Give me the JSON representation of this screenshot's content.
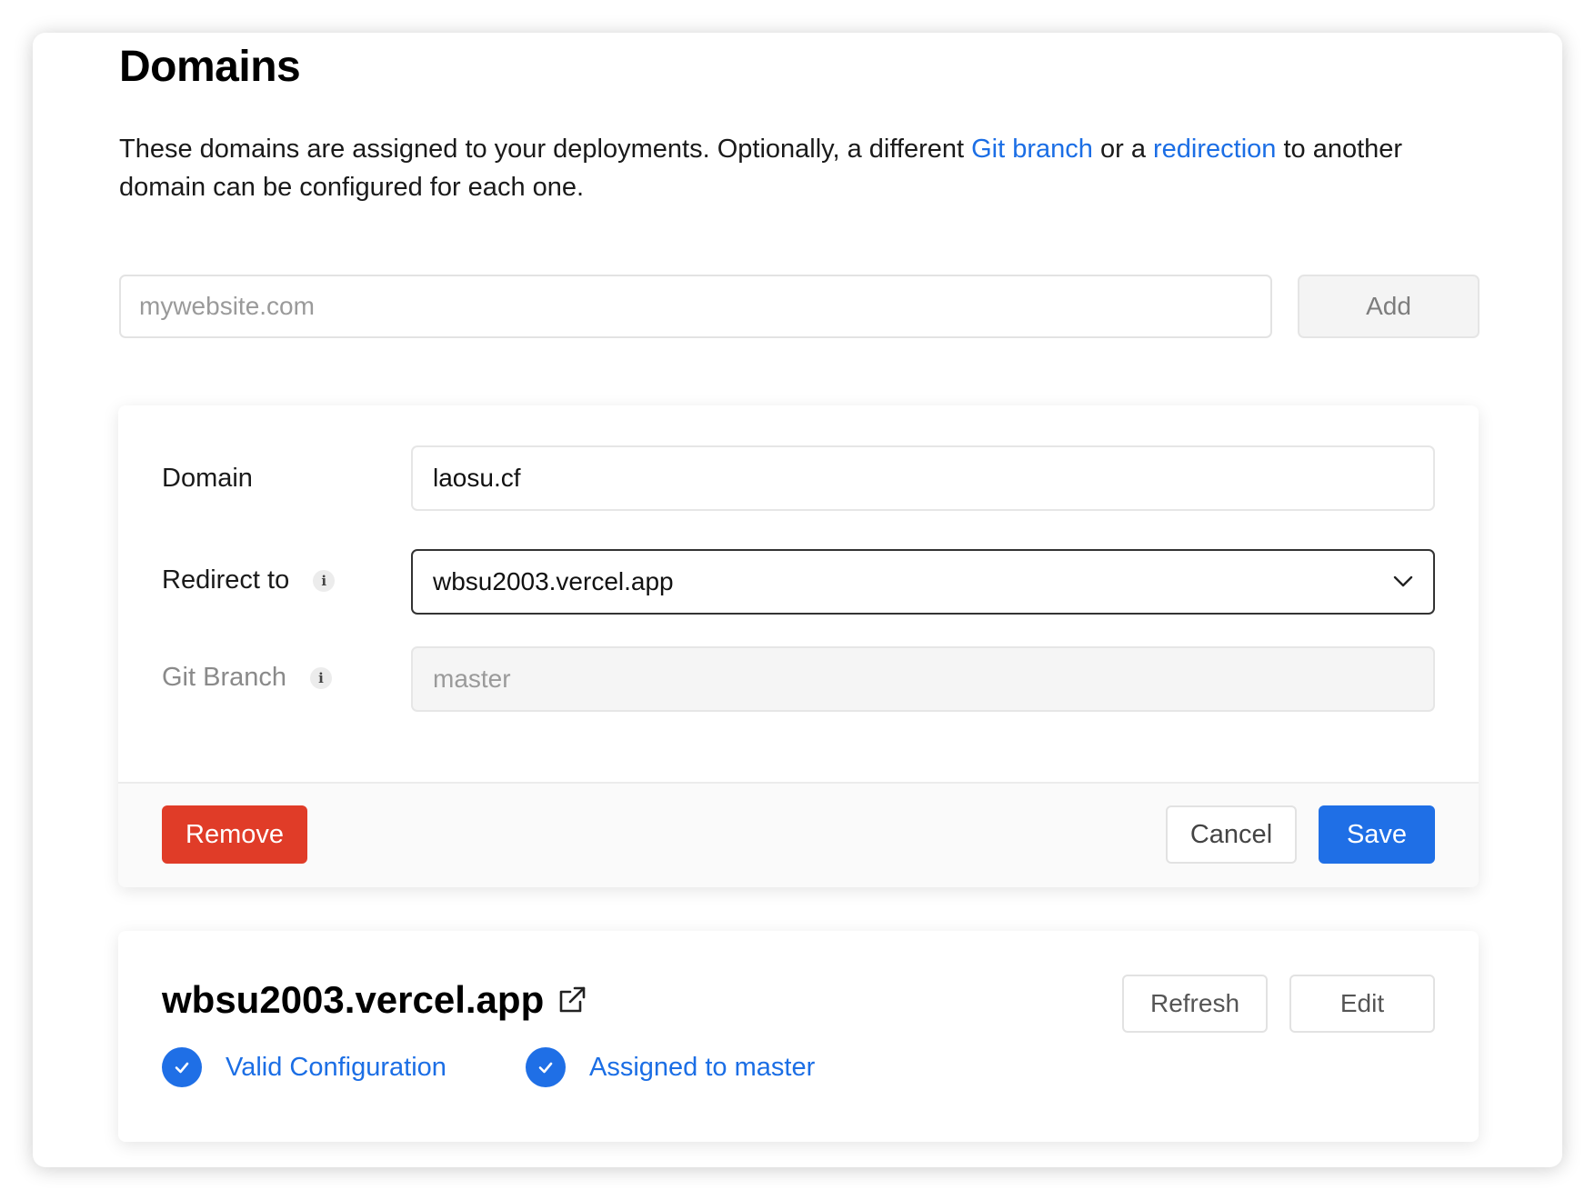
{
  "page": {
    "title": "Domains",
    "description_parts": {
      "text1": "These domains are assigned to your deployments. Optionally, a different ",
      "link1": "Git branch",
      "text2": " or a ",
      "link2": "redirection",
      "text3": " to another domain can be configured for each one."
    }
  },
  "add_domain": {
    "placeholder": "mywebsite.com",
    "value": "",
    "button_label": "Add"
  },
  "edit_form": {
    "domain_label": "Domain",
    "domain_value": "laosu.cf",
    "redirect_label": "Redirect to",
    "redirect_value": "wbsu2003.vercel.app",
    "git_branch_label": "Git Branch",
    "git_branch_placeholder": "master",
    "info_glyph": "i",
    "remove_label": "Remove",
    "cancel_label": "Cancel",
    "save_label": "Save"
  },
  "domain_card": {
    "name": "wbsu2003.vercel.app",
    "refresh_label": "Refresh",
    "edit_label": "Edit",
    "status_config": "Valid Configuration",
    "status_assigned": "Assigned to master"
  },
  "colors": {
    "accent_blue": "#1f6fe6",
    "link_blue": "#1b6ee5",
    "danger_red": "#e03c28"
  },
  "icons": [
    "info-icon",
    "chevron-down-icon",
    "external-link-icon",
    "check-circle-icon"
  ]
}
